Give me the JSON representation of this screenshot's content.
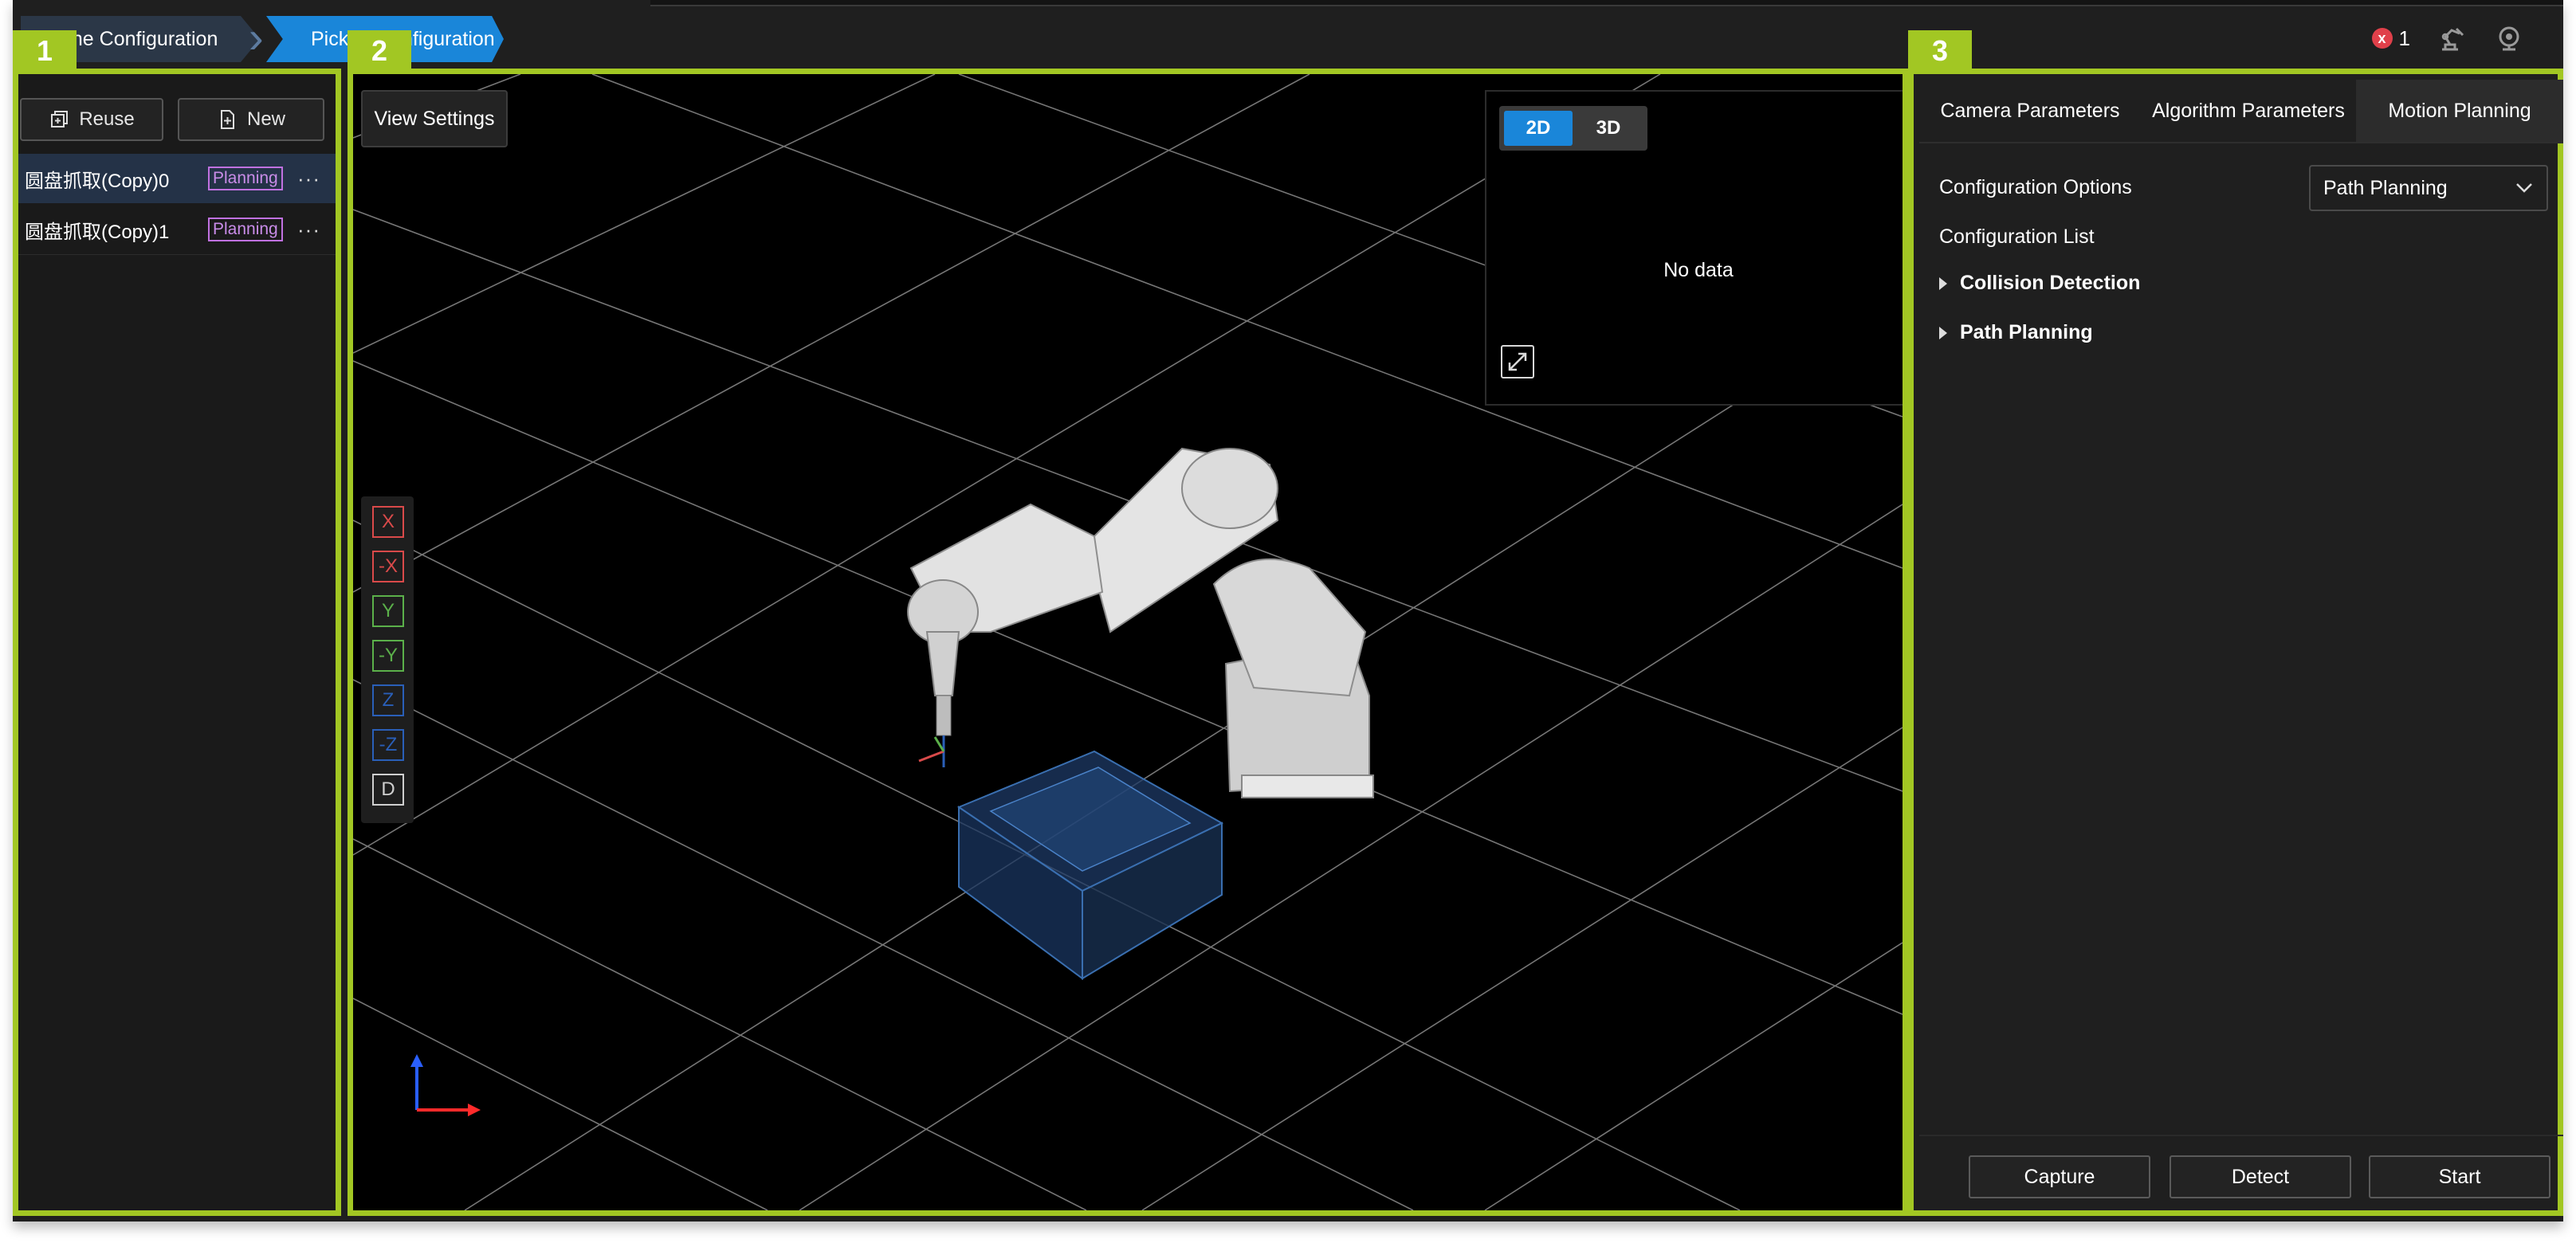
{
  "breadcrumb": {
    "step1": "ene Configuration",
    "step2": "Pickup Configuration"
  },
  "status": {
    "error_count": "1",
    "error_icon": "x"
  },
  "panel_numbers": {
    "left": "1",
    "center": "2",
    "right": "3"
  },
  "left_panel": {
    "reuse_label": "Reuse",
    "new_label": "New",
    "configs": [
      {
        "name": "圆盘抓取(Copy)0",
        "tag": "Planning",
        "menu": "···",
        "selected": true
      },
      {
        "name": "圆盘抓取(Copy)1",
        "tag": "Planning",
        "menu": "···",
        "selected": false
      }
    ]
  },
  "viewport": {
    "view_settings_label": "View Settings",
    "axis_buttons": [
      "X",
      "-X",
      "Y",
      "-Y",
      "Z",
      "-Z",
      "D"
    ],
    "axis_colors": [
      "#d94a4a",
      "#d94a4a",
      "#5bb04a",
      "#5bb04a",
      "#2a5fb8",
      "#2a5fb8",
      "#cfcfcf"
    ],
    "mini_view": {
      "mode_2d": "2D",
      "mode_3d": "3D",
      "active_mode": "2D",
      "no_data": "No data"
    }
  },
  "right_panel": {
    "tabs": [
      "Camera Parameters",
      "Algorithm Parameters",
      "Motion Planning"
    ],
    "active_tab": "Motion Planning",
    "config_options_label": "Configuration Options",
    "config_options_value": "Path Planning",
    "config_list_label": "Configuration List",
    "tree": [
      "Collision Detection",
      "Path Planning"
    ],
    "buttons": {
      "capture": "Capture",
      "detect": "Detect",
      "start": "Start"
    }
  },
  "colors": {
    "panel_border": "#a2c723",
    "accent_blue": "#1a86d9",
    "tag_purple": "#c071e0"
  }
}
